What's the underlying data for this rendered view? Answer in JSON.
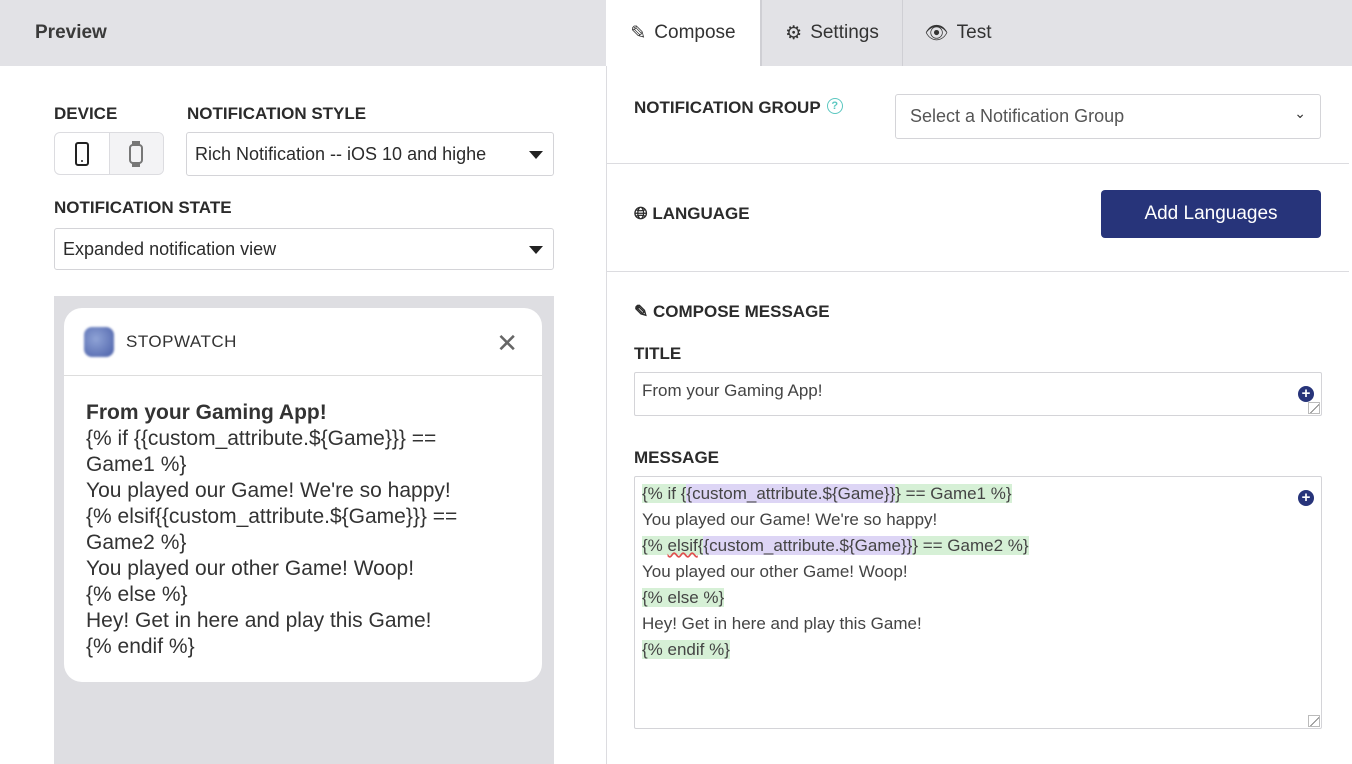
{
  "preview": {
    "title": "Preview",
    "device_label": "DEVICE",
    "devices": [
      "phone-icon",
      "watch-icon"
    ],
    "style_label": "NOTIFICATION STYLE",
    "style_value": "Rich Notification -- iOS 10 and highe",
    "state_label": "NOTIFICATION STATE",
    "state_value": "Expanded notification view",
    "notification": {
      "app_name": "STOPWATCH",
      "title": "From your Gaming App!",
      "body": [
        "{% if {{custom_attribute.${Game}}} ==",
        "Game1 %}",
        "You played our Game! We're so happy!",
        "{% elsif{{custom_attribute.${Game}}} ==",
        "Game2 %}",
        "You played our other Game! Woop!",
        "{% else %}",
        "Hey! Get in here and play this Game!",
        "{% endif %}"
      ]
    }
  },
  "tabs": [
    {
      "label": "Compose",
      "icon": "pencil-icon"
    },
    {
      "label": "Settings",
      "icon": "gear-icon"
    },
    {
      "label": "Test",
      "icon": "eye-icon"
    }
  ],
  "compose": {
    "group_label": "NOTIFICATION GROUP",
    "group_help": "?",
    "group_placeholder": "Select a Notification Group",
    "language_label": "LANGUAGE",
    "add_languages": "Add Languages",
    "compose_label": "COMPOSE MESSAGE",
    "title_label": "TITLE",
    "title_value": "From your Gaming App!",
    "message_label": "MESSAGE",
    "message_lines": [
      [
        {
          "t": "{% if {",
          "c": "g"
        },
        {
          "t": "{custom_attribute.${Game}}",
          "c": "p"
        },
        {
          "t": "} == Game1 %}",
          "c": "g"
        }
      ],
      [
        {
          "t": "You played our Game! We're so happy!",
          "c": ""
        }
      ],
      [
        {
          "t": "{% ",
          "c": "g"
        },
        {
          "t": "elsif",
          "c": "g sq"
        },
        {
          "t": "{",
          "c": "g"
        },
        {
          "t": "{custom_attribute.${Game}}",
          "c": "p"
        },
        {
          "t": "} == Game2 %}",
          "c": "g"
        }
      ],
      [
        {
          "t": "You played our other Game! Woop!",
          "c": ""
        }
      ],
      [
        {
          "t": "{% else %}",
          "c": "g"
        }
      ],
      [
        {
          "t": "Hey! Get in here and play this Game!",
          "c": ""
        }
      ],
      [
        {
          "t": "{% endif %}",
          "c": "g"
        }
      ]
    ]
  },
  "colors": {
    "primary": "#27347a",
    "highlight_liquid": "#d6f0d6",
    "highlight_attribute": "#ddd5f5"
  }
}
